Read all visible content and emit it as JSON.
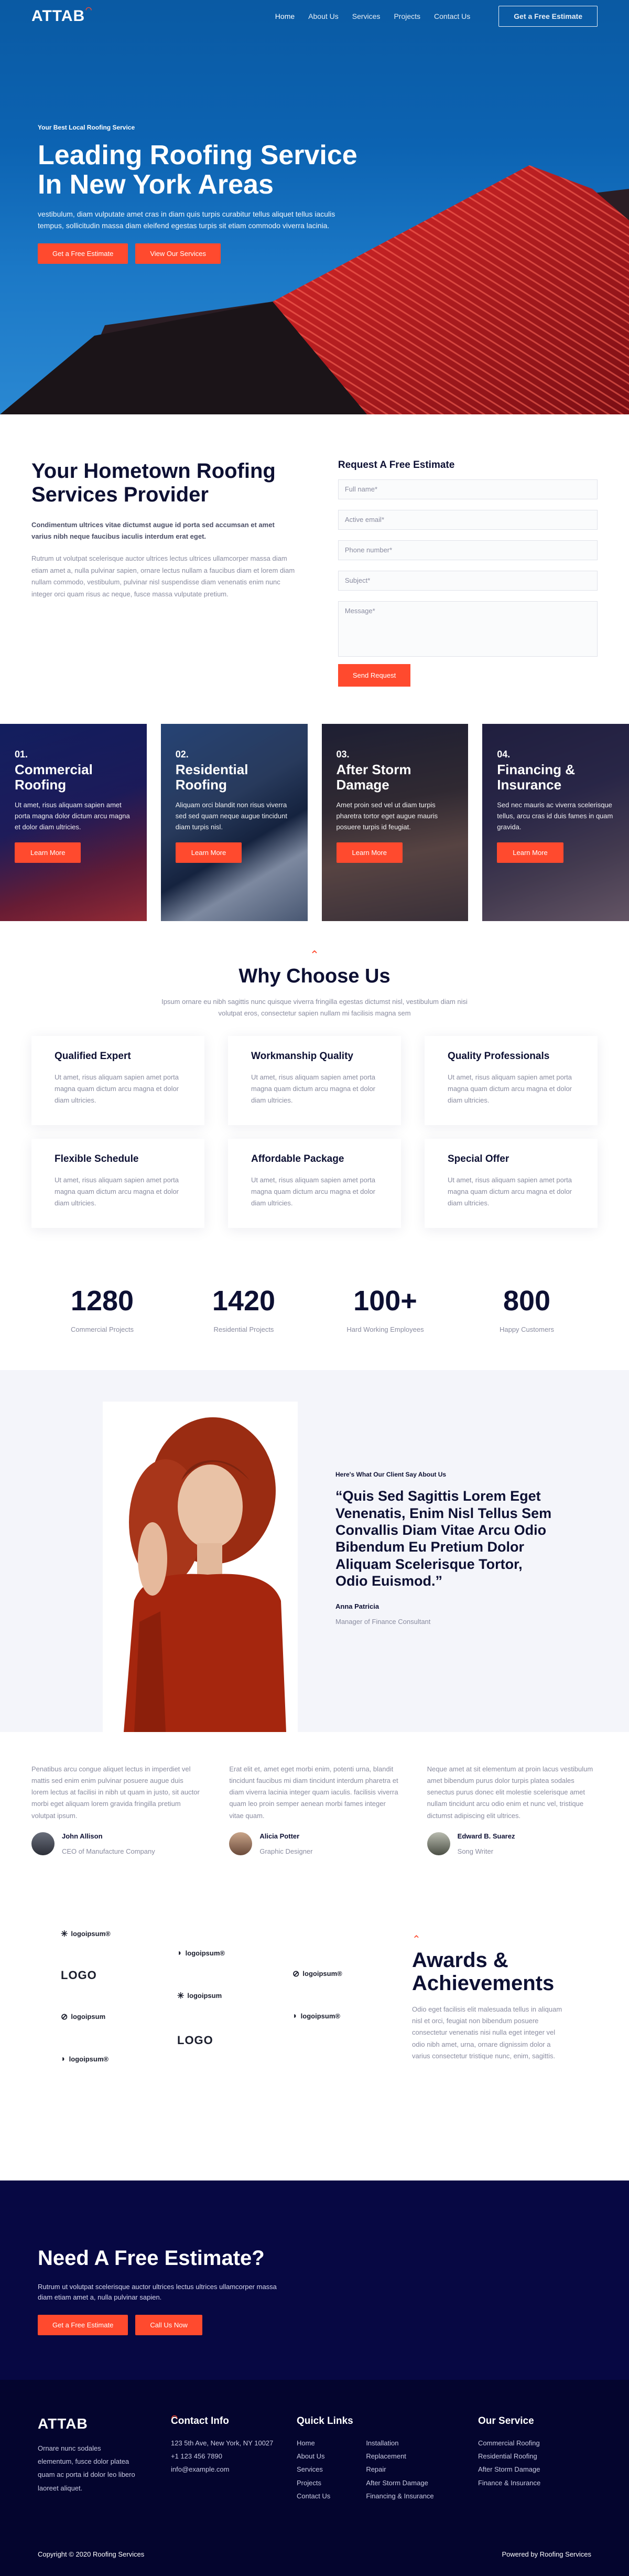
{
  "nav": {
    "logo": "ATTAB",
    "items": [
      "Home",
      "About Us",
      "Services",
      "Projects",
      "Contact Us"
    ],
    "cta": "Get a Free Estimate"
  },
  "hero": {
    "eyebrow": "Your Best Local Roofing Service",
    "title_1": "Leading Roofing Service",
    "title_2": "In New York Areas",
    "text": "vestibulum, diam vulputate amet cras in diam quis turpis curabitur tellus aliquet tellus iaculis tempus, sollicitudin massa diam eleifend egestas turpis sit etiam commodo viverra lacinia.",
    "btn1": "Get a Free Estimate",
    "btn2": "View Our Services"
  },
  "about": {
    "title_1": "Your Hometown Roofing",
    "title_2": "Services Provider",
    "lead": "Condimentum ultrices vitae dictumst augue id porta sed accumsan et amet varius nibh neque faucibus iaculis interdum erat eget.",
    "body": "Rutrum ut volutpat scelerisque auctor ultrices lectus ultrices ullamcorper massa diam etiam amet a, nulla pulvinar sapien, ornare lectus nullam a faucibus diam et lorem diam nullam commodo, vestibulum, pulvinar nisl suspendisse diam venenatis enim nunc integer orci quam risus ac neque, fusce massa vulputate pretium."
  },
  "form": {
    "title": "Request A Free Estimate",
    "full_name": "Full name*",
    "email": "Active email*",
    "phone": "Phone number*",
    "subject": "Subject*",
    "message": "Message*",
    "submit": "Send Request"
  },
  "services": [
    {
      "num": "01.",
      "title_1": "Commercial",
      "title_2": "Roofing",
      "text": "Ut amet, risus aliquam sapien amet porta magna dolor dictum arcu magna et dolor diam ultricies.",
      "btn": "Learn More"
    },
    {
      "num": "02.",
      "title_1": "Residential",
      "title_2": "Roofing",
      "text": "Aliquam orci blandit non risus viverra sed sed quam neque augue tincidunt diam turpis nisl.",
      "btn": "Learn More"
    },
    {
      "num": "03.",
      "title_1": "After Storm",
      "title_2": "Damage",
      "text": "Amet proin sed vel ut diam turpis pharetra tortor eget augue mauris posuere turpis id feugiat.",
      "btn": "Learn More"
    },
    {
      "num": "04.",
      "title_1": "Financing &",
      "title_2": "Insurance",
      "text": "Sed nec mauris ac viverra scelerisque tellus, arcu cras id duis fames in quam gravida.",
      "btn": "Learn More"
    }
  ],
  "why": {
    "title": "Why Choose Us",
    "intro": "Ipsum ornare eu nibh sagittis nunc quisque viverra fringilla egestas dictumst nisl, vestibulum diam nisi volutpat eros, consectetur sapien nullam mi facilisis magna sem",
    "cards": [
      {
        "title": "Qualified Expert",
        "text": "Ut amet, risus aliquam sapien amet porta magna quam dictum arcu magna et dolor diam ultricies."
      },
      {
        "title": "Workmanship Quality",
        "text": "Ut amet, risus aliquam sapien amet porta magna quam dictum arcu magna et dolor diam ultricies."
      },
      {
        "title": "Quality Professionals",
        "text": "Ut amet, risus aliquam sapien amet porta magna quam dictum arcu magna et dolor diam ultricies."
      },
      {
        "title": "Flexible Schedule",
        "text": "Ut amet, risus aliquam sapien amet porta magna quam dictum arcu magna et dolor diam ultricies."
      },
      {
        "title": "Affordable Package",
        "text": "Ut amet, risus aliquam sapien amet porta magna quam dictum arcu magna et dolor diam ultricies."
      },
      {
        "title": "Special Offer",
        "text": "Ut amet, risus aliquam sapien amet porta magna quam dictum arcu magna et dolor diam ultricies."
      }
    ]
  },
  "stats": [
    {
      "value": "1280",
      "label": "Commercial Projects"
    },
    {
      "value": "1420",
      "label": "Residential Projects"
    },
    {
      "value": "100+",
      "label": "Hard Working Employees"
    },
    {
      "value": "800",
      "label": "Happy Customers"
    }
  ],
  "testimonial": {
    "eyebrow": "Here's What Our Client Say About Us",
    "quote": "“Quis Sed Sagittis Lorem Eget Venenatis, Enim Nisl Tellus Sem Convallis Diam Vitae Arcu Odio Bibendum Eu Pretium Dolor Aliquam Scelerisque Tortor, Odio Euismod.”",
    "name": "Anna Patricia",
    "role": "Manager of Finance Consultant"
  },
  "reviews": [
    {
      "text": "Penatibus arcu congue aliquet lectus in imperdiet vel mattis sed enim enim pulvinar posuere augue duis lorem lectus at facilisi in nibh ut quam in justo, sit auctor morbi eget aliquam lorem gravida fringilla pretium volutpat ipsum.",
      "name": "John Allison",
      "role": "CEO of Manufacture Company"
    },
    {
      "text": "Erat elit et, amet eget morbi enim, potenti urna, blandit tincidunt faucibus mi diam tincidunt interdum pharetra et diam viverra lacinia integer quam iaculis. facilisis viverra quam leo proin semper aenean morbi fames integer vitae quam.",
      "name": "Alicia Potter",
      "role": "Graphic Designer"
    },
    {
      "text": "Neque amet at sit elementum at proin lacus vestibulum amet bibendum purus dolor turpis platea sodales senectus purus donec elit molestie scelerisque amet nullam tincidunt arcu odio enim et nunc vel, tristique dictumst adipiscing elit ultrices.",
      "name": "Edward B. Suarez",
      "role": "Song Writer"
    }
  ],
  "logos": [
    "logoipsum®",
    "LOGO",
    "logoipsum",
    "logoipsum®",
    "logoipsum®",
    "LOGO",
    "logoipsum",
    "logoipsum®",
    "logoipsum®"
  ],
  "awards": {
    "title_1": "Awards &",
    "title_2": "Achievements",
    "text": "Odio eget facilisis elit malesuada tellus in aliquam nisl et orci, feugiat non bibendum posuere consectetur venenatis nisi nulla eget integer vel odio nibh amet, urna, ornare dignissim dolor a varius consectetur tristique nunc, enim, sagittis."
  },
  "cta": {
    "title": "Need A Free Estimate?",
    "text": "Rutrum ut volutpat scelerisque auctor ultrices lectus ultrices ullamcorper massa diam etiam amet a, nulla pulvinar sapien.",
    "btn1": "Get a Free Estimate",
    "btn2": "Call Us Now"
  },
  "footer": {
    "logo": "ATTAB",
    "about": "Ornare nunc sodales elementum, fusce dolor platea quam ac porta id dolor leo libero laoreet aliquet.",
    "contact_title": "Contact Info",
    "contact": [
      "123 5th Ave, New York, NY 10027",
      "+1 123 456 7890",
      "info@example.com"
    ],
    "links_title": "Quick Links",
    "links_a": [
      "Home",
      "About Us",
      "Services",
      "Projects",
      "Contact Us"
    ],
    "links_b": [
      "Installation",
      "Replacement",
      "Repair",
      "After Storm Damage",
      "Financing & Insurance"
    ],
    "service_title": "Our Service",
    "service": [
      "Commercial Roofing",
      "Residential Roofing",
      "After Storm Damage",
      "Finance & Insurance"
    ],
    "copyright": "Copyright © 2020 Roofing Services",
    "powered": "Powered by Roofing Services"
  },
  "colors": {
    "accent": "#ff4a2e",
    "navy": "#070843",
    "hero_blue": "#0c63b2"
  }
}
